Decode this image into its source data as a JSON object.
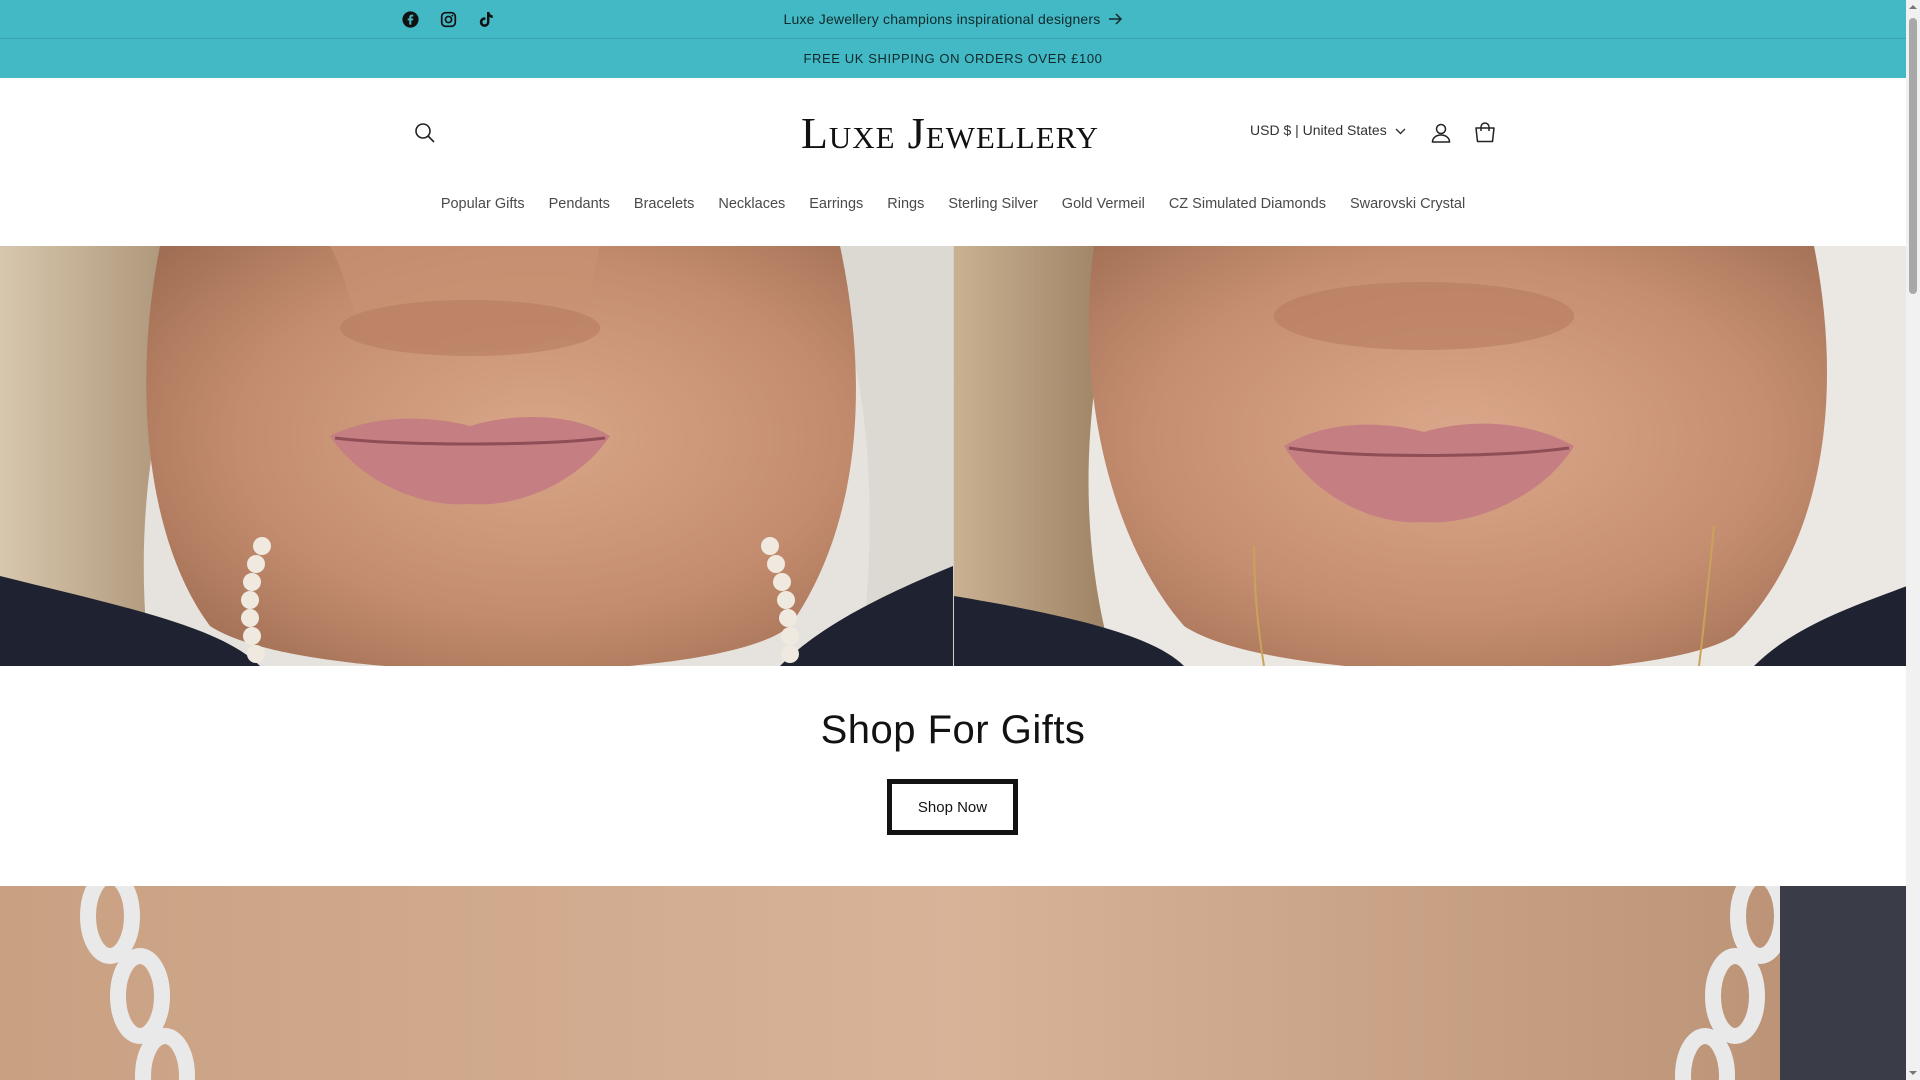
{
  "announcement": {
    "text": "Luxe Jewellery champions inspirational designers",
    "shipping": "FREE UK SHIPPING ON ORDERS OVER £100"
  },
  "social": [
    "facebook-icon",
    "instagram-icon",
    "tiktok-icon"
  ],
  "header": {
    "logo": "Luxe Jewellery",
    "currency": "USD $ | United States"
  },
  "nav": {
    "items": [
      {
        "label": "Popular Gifts"
      },
      {
        "label": "Pendants"
      },
      {
        "label": "Bracelets"
      },
      {
        "label": "Necklaces"
      },
      {
        "label": "Earrings"
      },
      {
        "label": "Rings"
      },
      {
        "label": "Sterling Silver"
      },
      {
        "label": "Gold Vermeil"
      },
      {
        "label": "CZ Simulated Diamonds"
      },
      {
        "label": "Swarovski Crystal"
      }
    ]
  },
  "gifts": {
    "heading": "Shop For Gifts",
    "button": "Shop Now"
  },
  "colors": {
    "announcement_bg": "#42b9c4",
    "text": "#121212"
  }
}
